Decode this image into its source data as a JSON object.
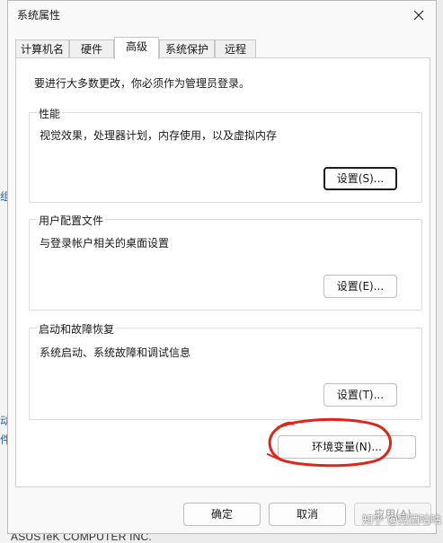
{
  "dialog": {
    "title": "系统属性",
    "close_icon": "close-icon"
  },
  "tabs": [
    {
      "label": "计算机名",
      "active": false
    },
    {
      "label": "硬件",
      "active": false
    },
    {
      "label": "高级",
      "active": true
    },
    {
      "label": "系统保护",
      "active": false
    },
    {
      "label": "远程",
      "active": false
    }
  ],
  "advanced": {
    "notice": "要进行大多数更改，你必须作为管理员登录。",
    "performance": {
      "label": "性能",
      "description": "视觉效果，处理器计划，内存使用，以及虚拟内存",
      "button": "设置(S)..."
    },
    "user_profiles": {
      "label": "用户配置文件",
      "description": "与登录帐户相关的桌面设置",
      "button": "设置(E)..."
    },
    "startup_recovery": {
      "label": "启动和故障恢复",
      "description": "系统启动、系统故障和调试信息",
      "button": "设置(T)..."
    },
    "env_button": "环境变量(N)..."
  },
  "footer": {
    "ok": "确定",
    "cancel": "取消",
    "apply": "应用(A)"
  },
  "background": {
    "frag1": "组",
    "frag2": "动",
    "frag3": "件",
    "bottom_text": "ASUSTeK COMPUTER INC."
  },
  "watermark": "知乎 @晃酒咕咕",
  "colors": {
    "annotation_red": "#e2231a",
    "focus_border": "#1d1d1d"
  }
}
